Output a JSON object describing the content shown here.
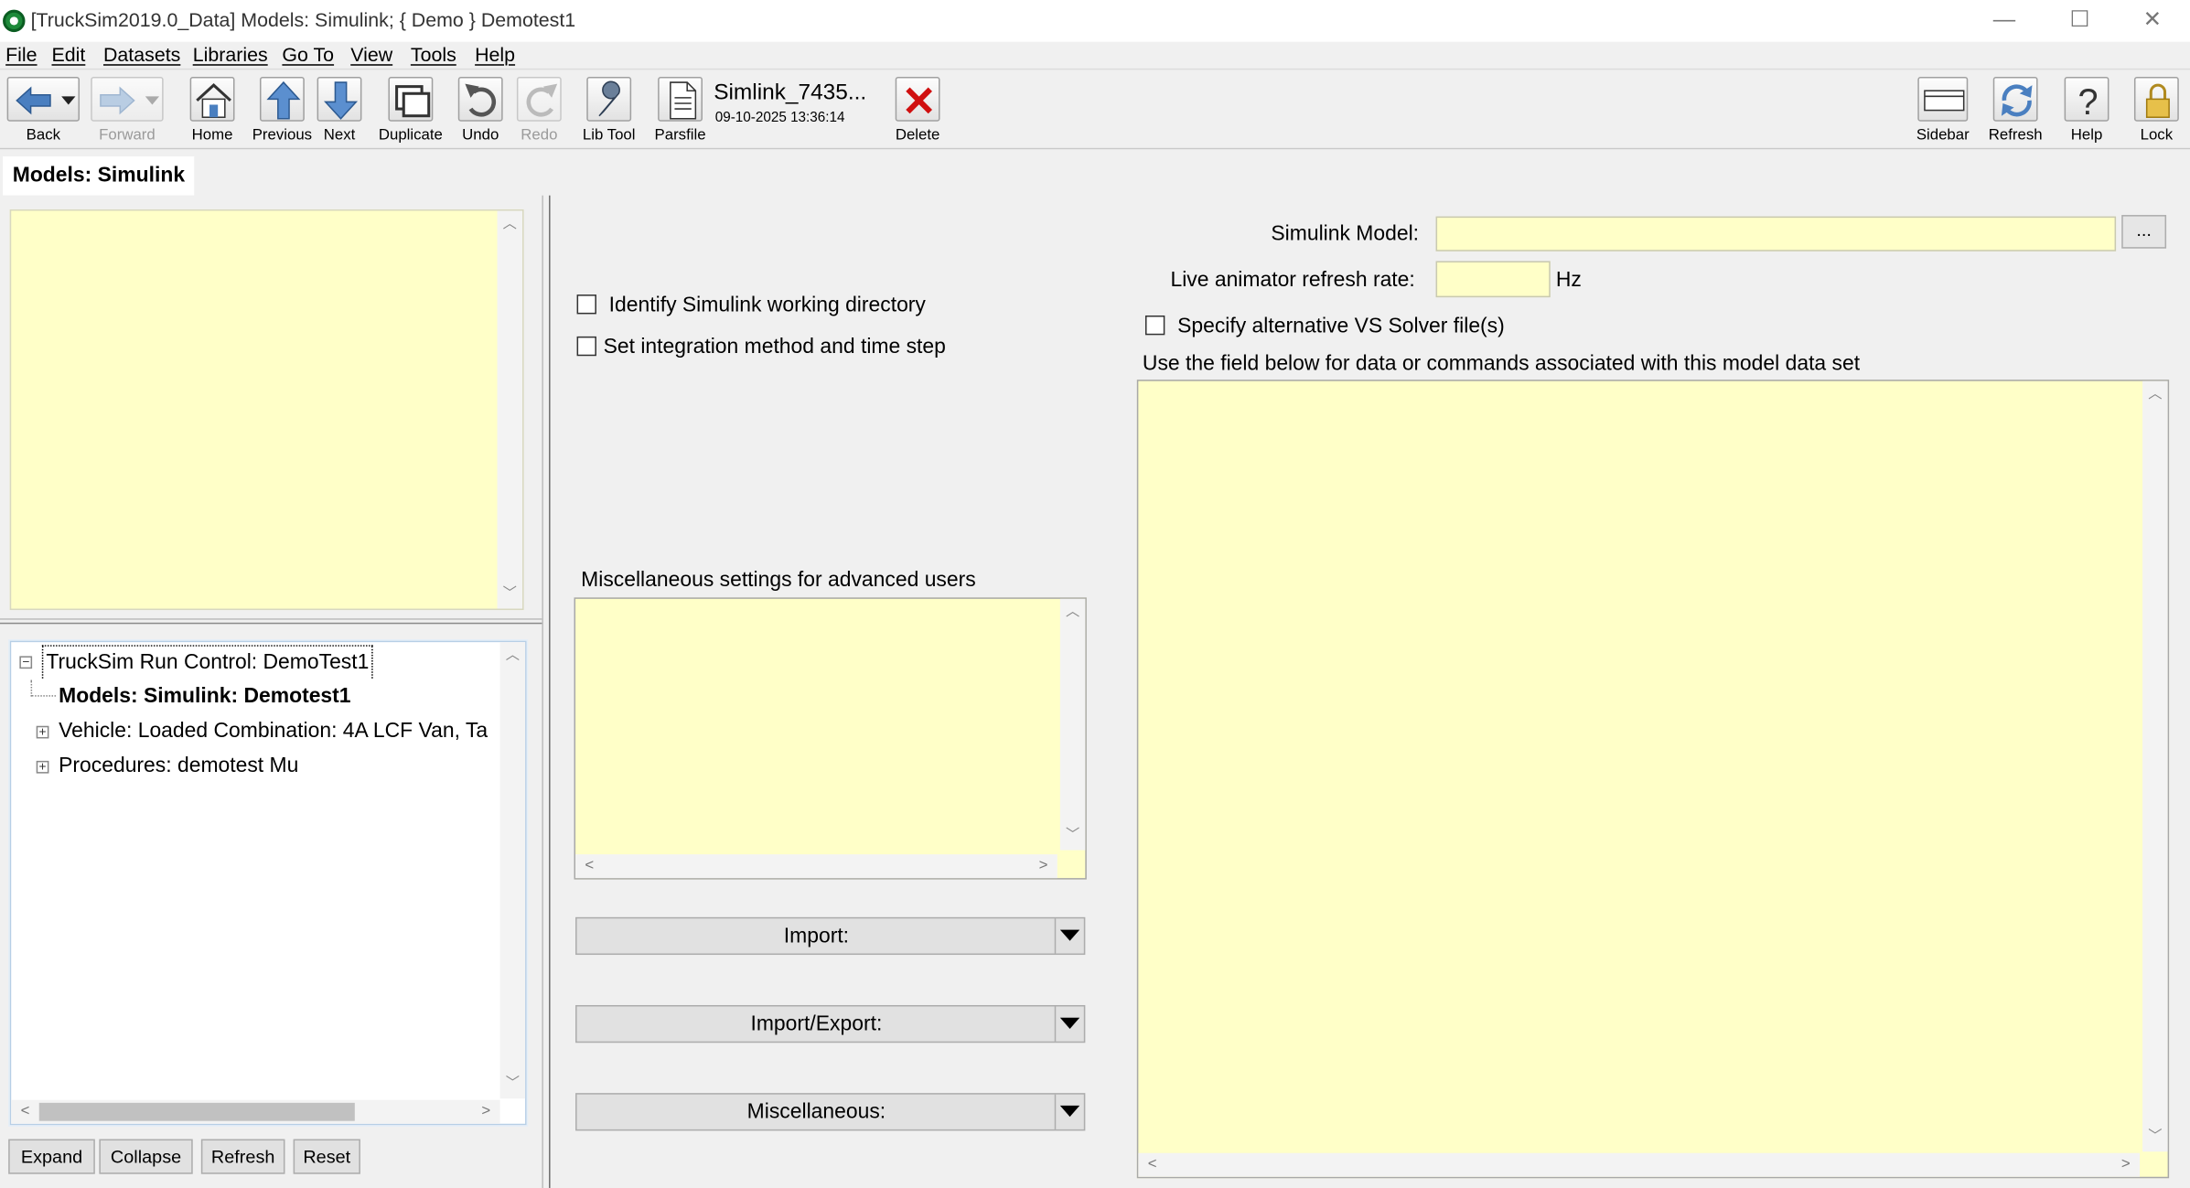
{
  "window": {
    "title": "[TruckSim2019.0_Data] Models: Simulink; { Demo } Demotest1",
    "minimize": "—",
    "maximize": "☐",
    "close": "✕"
  },
  "menu": [
    "File",
    "Edit",
    "Datasets",
    "Libraries",
    "Go To",
    "View",
    "Tools",
    "Help"
  ],
  "toolbar": {
    "back": "Back",
    "forward": "Forward",
    "home": "Home",
    "previous": "Previous",
    "next": "Next",
    "duplicate": "Duplicate",
    "undo": "Undo",
    "redo": "Redo",
    "libtool": "Lib Tool",
    "parsfile": "Parsfile",
    "dataset_name": "Simlink_7435...",
    "dataset_date": "09-10-2025 13:36:14",
    "delete": "Delete",
    "sidebar": "Sidebar",
    "refresh": "Refresh",
    "help": "Help",
    "lock": "Lock"
  },
  "tab": {
    "title": "Models: Simulink"
  },
  "tree": {
    "root": "TruckSim Run Control: DemoTest1",
    "items": [
      "Models: Simulink: Demotest1",
      "Vehicle: Loaded Combination: 4A LCF Van, Ta",
      "Procedures: demotest Mu"
    ]
  },
  "tree_buttons": {
    "expand": "Expand",
    "collapse": "Collapse",
    "refresh": "Refresh",
    "reset": "Reset"
  },
  "options": {
    "identify_wd": "Identify Simulink working directory",
    "set_integration": "Set integration method and time step",
    "misc_label": "Miscellaneous settings for advanced users"
  },
  "dropdowns": {
    "import": "Import:",
    "import_export": "Import/Export:",
    "misc": "Miscellaneous:"
  },
  "model": {
    "simulink_model_label": "Simulink Model:",
    "browse": "...",
    "refresh_rate_label": "Live animator refresh rate:",
    "hz": "Hz",
    "alt_solver": "Specify alternative VS Solver file(s)",
    "field_hint": "Use the field below  for data or commands associated with this model data set"
  }
}
